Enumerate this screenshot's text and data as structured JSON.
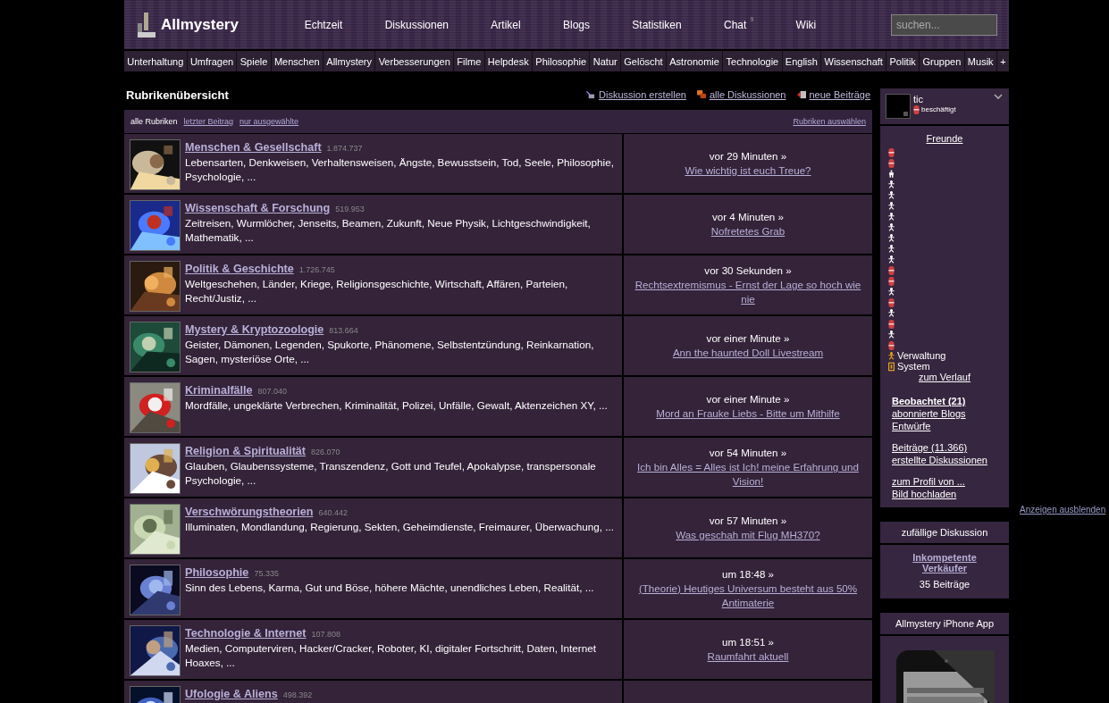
{
  "header": {
    "logo": "Allmystery",
    "nav": [
      {
        "label": "Echtzeit"
      },
      {
        "label": "Diskussionen"
      },
      {
        "label": "Artikel"
      },
      {
        "label": "Blogs"
      },
      {
        "label": "Statistiken"
      },
      {
        "label": "Chat",
        "badge": "9"
      },
      {
        "label": "Wiki"
      }
    ],
    "search": {
      "placeholder": "suchen..."
    }
  },
  "categories": [
    "Unterhaltung",
    "Umfragen",
    "Spiele",
    "Menschen",
    "Allmystery",
    "Verbesserungen",
    "Filme",
    "Helpdesk",
    "Philosophie",
    "Natur",
    "Gelöscht",
    "Astronomie",
    "Technologie",
    "English",
    "Wissenschaft",
    "Politik",
    "Gruppen",
    "Musik",
    "+"
  ],
  "overview": {
    "title": "Rubrikenübersicht",
    "actions": [
      {
        "kind": "create",
        "label": "Diskussion erstellen"
      },
      {
        "kind": "list",
        "label": "alle Diskussionen"
      },
      {
        "kind": "new",
        "label": "neue Beiträge"
      }
    ],
    "tabs": [
      {
        "label": "alle Rubriken",
        "selected": true
      },
      {
        "label": "letzter Beitrag",
        "selected": false
      },
      {
        "label": "nur ausgewählte",
        "selected": false
      }
    ],
    "select_link": "Rubriken auswählen"
  },
  "rubrics": [
    {
      "name": "Menschen & Gesellschaft",
      "count": "1.874.737",
      "topics": "Lebensarten, Denkweisen, Verhaltensweisen, Ängste, Bewusstsein, Tod, Seele, Philosophie, Psychologie, ...",
      "last_time": "vor 29 Minuten »",
      "last_title": "Wie wichtig ist euch Treue?"
    },
    {
      "name": "Wissenschaft & Forschung",
      "count": "519.953",
      "topics": "Zeitreisen, Wurmlöcher, Jenseits, Beamen, Zukunft, Neue Physik, Lichtgeschwindigkeit, Mathematik, ...",
      "last_time": "vor 4 Minuten »",
      "last_title": "Nofretetes Grab"
    },
    {
      "name": "Politik & Geschichte",
      "count": "1.726.745",
      "topics": "Weltgeschehen, Länder, Kriege, Religionsgeschichte, Wirtschaft, Affären, Parteien, Recht/Justiz, ...",
      "last_time": "vor 30 Sekunden »",
      "last_title": "Rechtsextremismus - Ernst der Lage so hoch wie nie"
    },
    {
      "name": "Mystery & Kryptozoologie",
      "count": "813.664",
      "topics": "Geister, Dämonen, Legenden, Spukorte, Phänomene, Selbstentzündung, Reinkarnation, Sagen, mysteriöse Orte, ...",
      "last_time": "vor einer Minute »",
      "last_title": "Ann the haunted Doll Livestream"
    },
    {
      "name": "Kriminalfälle",
      "count": "807.040",
      "topics": "Mordfälle, ungeklärte Verbrechen, Kriminalität, Polizei, Unfälle, Gewalt, Aktenzeichen XY, ...",
      "last_time": "vor einer Minute »",
      "last_title": "Mord an Frauke Liebs - Bitte um Mithilfe"
    },
    {
      "name": "Religion & Spiritualität",
      "count": "826.070",
      "topics": "Glauben, Glaubenssysteme, Transzendenz, Gott und Teufel, Apokalypse, transpersonale Psychologie, ...",
      "last_time": "vor 54 Minuten »",
      "last_title": "Ich bin Alles = Alles ist Ich! meine Erfahrung und Vision!"
    },
    {
      "name": "Verschwörungstheorien",
      "count": "640.442",
      "topics": "Illuminaten, Mondlandung, Regierung, Sekten, Geheimdienste, Freimaurer, Überwachung, ...",
      "last_time": "vor 57 Minuten »",
      "last_title": "Was geschah mit Flug MH370?"
    },
    {
      "name": "Philosophie",
      "count": "75.335",
      "topics": "Sinn des Lebens, Karma, Gut und Böse, höhere Mächte, unendliches Leben, Realität, ...",
      "last_time": "um 18:48 »",
      "last_title": "(Theorie) Heutiges Universum besteht aus 50% Antimaterie"
    },
    {
      "name": "Technologie & Internet",
      "count": "107.808",
      "topics": "Medien, Computerviren, Hacker/Cracker, Roboter, KI, digitaler Fortschritt, Daten, Internet Hoaxes, ...",
      "last_time": "um 18:51 »",
      "last_title": "Raumfahrt aktuell"
    },
    {
      "name": "Ufologie & Aliens",
      "count": "498.392"
    }
  ],
  "sidebar": {
    "user": {
      "name": "tic",
      "status": "beschäftigt"
    },
    "friends_title": "Freunde",
    "friends": [
      {
        "kind": "busy"
      },
      {
        "kind": "busy"
      },
      {
        "kind": "idle"
      },
      {
        "kind": "online"
      },
      {
        "kind": "online"
      },
      {
        "kind": "online"
      },
      {
        "kind": "online"
      },
      {
        "kind": "online"
      },
      {
        "kind": "online"
      },
      {
        "kind": "online"
      },
      {
        "kind": "online"
      },
      {
        "kind": "busy"
      },
      {
        "kind": "busy"
      },
      {
        "kind": "online"
      },
      {
        "kind": "busy"
      },
      {
        "kind": "online"
      },
      {
        "kind": "busy"
      },
      {
        "kind": "online"
      },
      {
        "kind": "busy"
      }
    ],
    "groups": [
      {
        "kind": "admin",
        "label": "Verwaltung"
      },
      {
        "kind": "system",
        "label": "System"
      }
    ],
    "history_link": "zum Verlauf",
    "link_groups": [
      [
        {
          "label": "Beobachtet (21)",
          "bold": true
        },
        {
          "label": "abonnierte Blogs",
          "bold": false
        },
        {
          "label": "Entwürfe",
          "bold": false
        }
      ],
      [
        {
          "label": "Beiträge (11.366)",
          "bold": false
        },
        {
          "label": "erstellte Diskussionen",
          "bold": false
        }
      ],
      [
        {
          "label": "zum Profil von ...",
          "bold": false
        },
        {
          "label": "Bild hochladen",
          "bold": false
        }
      ]
    ]
  },
  "random": {
    "title": "zufällige Diskussion",
    "link": "Inkompetente Verkäufer",
    "posts": "35 Beiträge"
  },
  "app_box": {
    "title": "Allmystery iPhone App"
  },
  "hide_ads": "Anzeigen ausblenden"
}
